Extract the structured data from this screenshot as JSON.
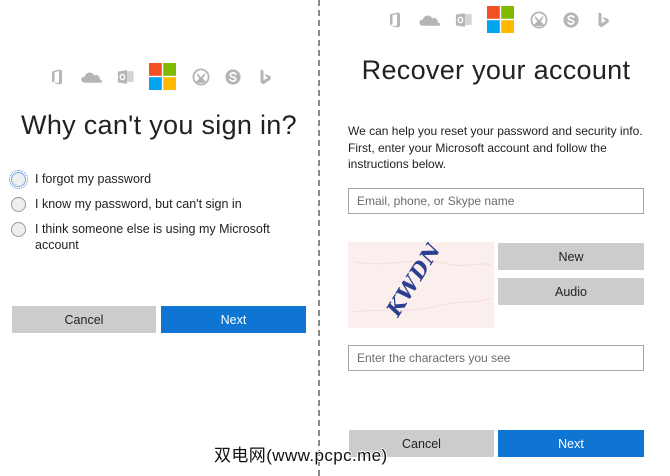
{
  "left": {
    "icons": [
      "office-icon",
      "onedrive-icon",
      "outlook-icon",
      "microsoft-logo",
      "xbox-icon",
      "skype-icon",
      "bing-icon"
    ],
    "title": "Why can't you sign in?",
    "options": [
      {
        "label": "I forgot my password",
        "selected": false,
        "focused": true
      },
      {
        "label": "I know my password, but can't sign in",
        "selected": false,
        "focused": false
      },
      {
        "label": "I think someone else is using my Microsoft account",
        "selected": false,
        "focused": false
      }
    ],
    "cancel_label": "Cancel",
    "next_label": "Next"
  },
  "right": {
    "icons": [
      "office-icon",
      "onedrive-icon",
      "outlook-icon",
      "microsoft-logo",
      "xbox-icon",
      "skype-icon",
      "bing-icon"
    ],
    "title": "Recover your account",
    "intro": "We can help you reset your password and security info. First, enter your Microsoft account and follow the instructions below.",
    "account_input": {
      "placeholder": "Email, phone, or Skype name",
      "value": ""
    },
    "captcha_text": "KWDN",
    "new_label": "New",
    "audio_label": "Audio",
    "captcha_input": {
      "placeholder": "Enter the characters you see",
      "value": ""
    },
    "cancel_label": "Cancel",
    "next_label": "Next"
  },
  "watermark": "双电网(www.pcpc.me)",
  "colors": {
    "accent_blue": "#0e75d3",
    "gray_button": "#cccccc",
    "icon_gray": "#b5b5b5",
    "ms_red": "#f25022",
    "ms_green": "#7fba00",
    "ms_blue": "#00a4ef",
    "ms_yellow": "#ffb900",
    "captcha_bg": "#fbefee",
    "captcha_ink": "#2a3f8f"
  }
}
